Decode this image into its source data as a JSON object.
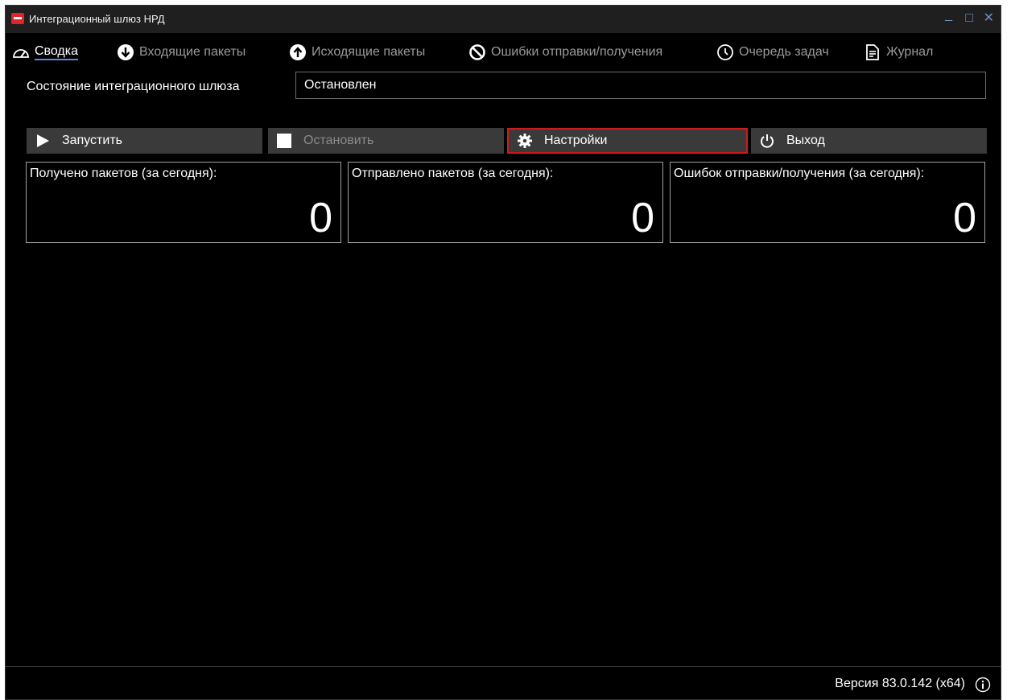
{
  "window": {
    "title": "Интеграционный шлюз НРД",
    "controls": {
      "minimize": "_",
      "maximize": "□",
      "close": "✕"
    },
    "accent_color": "#5a8ae0",
    "focus_color": "#d01a1a"
  },
  "tabs": [
    {
      "label": "Сводка",
      "icon": "gauge-icon",
      "active": true
    },
    {
      "label": "Входящие пакеты",
      "icon": "arrow-down-circle-icon",
      "active": false
    },
    {
      "label": "Исходящие пакеты",
      "icon": "arrow-up-circle-icon",
      "active": false
    },
    {
      "label": "Ошибки отправки/получения",
      "icon": "prohibited-icon",
      "active": false
    },
    {
      "label": "Очередь задач",
      "icon": "clock-icon",
      "active": false
    },
    {
      "label": "Журнал",
      "icon": "document-icon",
      "active": false
    }
  ],
  "gateway_status": {
    "label": "Состояние интеграционного шлюза",
    "value": "Остановлен"
  },
  "buttons": {
    "start": "Запустить",
    "stop": "Остановить",
    "settings": "Настройки",
    "exit": "Выход"
  },
  "stats": [
    {
      "label": "Получено пакетов (за сегодня):",
      "value": "0"
    },
    {
      "label": "Отправлено пакетов (за сегодня):",
      "value": "0"
    },
    {
      "label": "Ошибок отправки/получения (за сегодня):",
      "value": "0"
    }
  ],
  "footer": {
    "version": "Версия 83.0.142 (x64)"
  }
}
